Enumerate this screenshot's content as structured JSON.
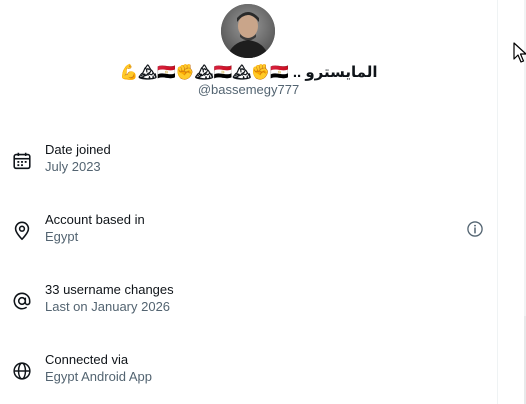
{
  "profile": {
    "display_name": "💪🏔🇪🇬✊🏔🇪🇬🏔✊🇪🇬 .. المايسترو",
    "handle": "@bassemegy777"
  },
  "rows": [
    {
      "icon": "calendar-icon",
      "title": "Date joined",
      "subtitle": "July 2023"
    },
    {
      "icon": "location-pin-icon",
      "title": "Account based in",
      "subtitle": "Egypt",
      "action_icon": "info-icon"
    },
    {
      "icon": "at-sign-icon",
      "title": "33 username changes",
      "subtitle": "Last on January 2026"
    },
    {
      "icon": "globe-icon",
      "title": "Connected via",
      "subtitle": "Egypt Android App"
    }
  ],
  "colors": {
    "primary_text": "#0f1419",
    "secondary_text": "#536471",
    "divider": "#eff3f4"
  }
}
